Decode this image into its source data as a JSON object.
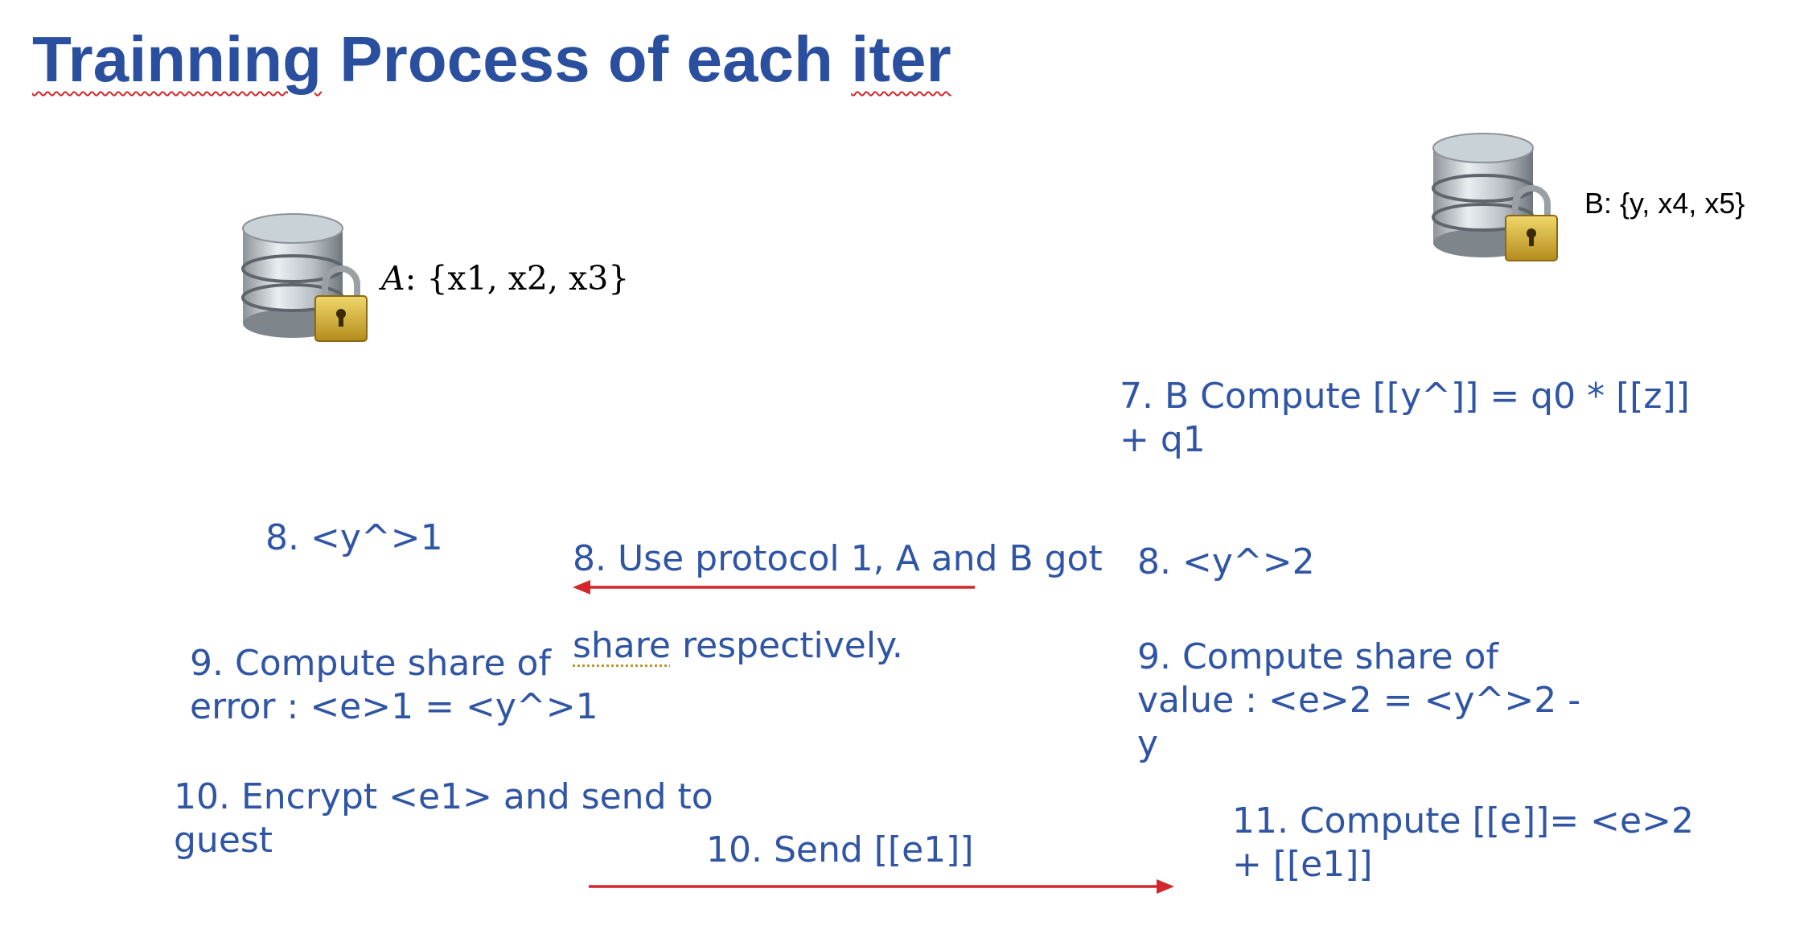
{
  "title": {
    "word1": "Trainning",
    "middle": " Process of each ",
    "word2": "iter"
  },
  "party_a": {
    "label_italic": "A",
    "label_rest": ": {x1, x2, x3}",
    "icon": "database-lock-icon"
  },
  "party_b": {
    "label": "B: {y, x4, x5}",
    "icon": "database-lock-icon"
  },
  "steps": {
    "b_step7": "7. B Compute [[y^]] = q0 * [[z]]\n+ q1",
    "a_step8": "8. <y^>1",
    "mid_step8_line1": "8. Use protocol 1, A and B got",
    "mid_step8_share": "share",
    "mid_step8_rest": " respectively.",
    "b_step8": "8. <y^>2",
    "a_step9": "9. Compute share of\nerror : <e>1 = <y^>1",
    "b_step9": "9. Compute share of\nvalue : <e>2 = <y^>2 -\ny",
    "a_step10": "10. Encrypt <e1> and send to\nguest",
    "mid_step10": "10. Send [[e1]]",
    "b_step11": "11. Compute [[e]]= <e>2\n+ [[e1]]"
  },
  "colors": {
    "title": "#2a4f9e",
    "text": "#2f55a4",
    "arrow": "#d4272b"
  }
}
